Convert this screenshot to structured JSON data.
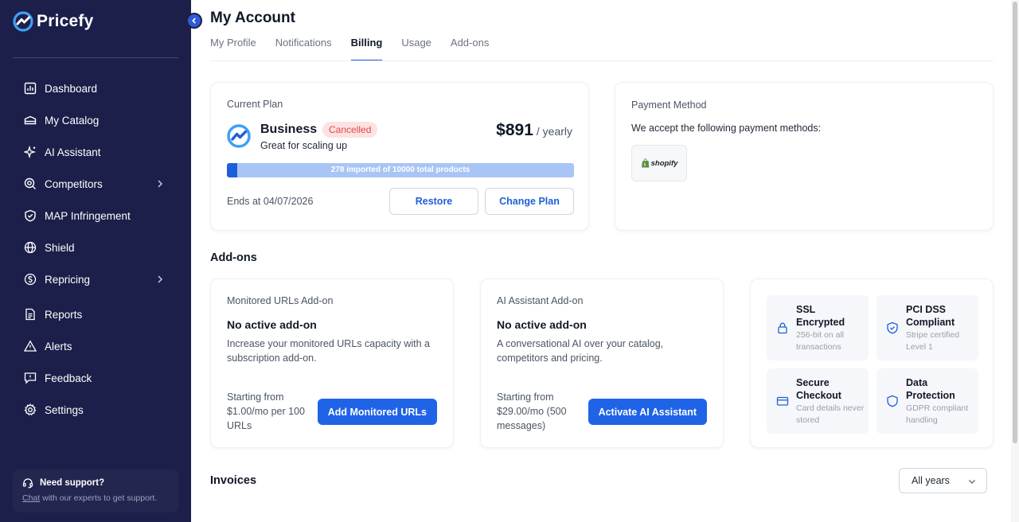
{
  "app": {
    "name": "Pricefy",
    "accent": "#1f5fd9",
    "sidebar_bg": "#1c1f4a"
  },
  "sidebar": {
    "items": [
      {
        "label": "Dashboard",
        "icon": "dashboard-icon"
      },
      {
        "label": "My Catalog",
        "icon": "catalog-icon"
      },
      {
        "label": "AI Assistant",
        "icon": "sparkle-icon"
      },
      {
        "label": "Competitors",
        "icon": "competitors-icon",
        "has_submenu": true
      },
      {
        "label": "MAP Infringement",
        "icon": "shield-check-icon"
      },
      {
        "label": "Shield",
        "icon": "globe-icon"
      },
      {
        "label": "Repricing",
        "icon": "repricing-icon",
        "has_submenu": true
      },
      {
        "label": "Reports",
        "icon": "document-icon"
      },
      {
        "label": "Alerts",
        "icon": "warning-icon"
      },
      {
        "label": "Feedback",
        "icon": "feedback-icon"
      },
      {
        "label": "Settings",
        "icon": "gear-icon"
      }
    ],
    "support": {
      "title": "Need support?",
      "link": "Chat",
      "text": " with our experts to get support."
    }
  },
  "page": {
    "title": "My Account",
    "tabs": [
      {
        "label": "My Profile",
        "active": false
      },
      {
        "label": "Notifications",
        "active": false
      },
      {
        "label": "Billing",
        "active": true
      },
      {
        "label": "Usage",
        "active": false
      },
      {
        "label": "Add-ons",
        "active": false
      }
    ]
  },
  "plan": {
    "card_title": "Current Plan",
    "name": "Business",
    "status": "Cancelled",
    "tagline": "Great for scaling up",
    "price": "$891",
    "period": "/ yearly",
    "progress_label": "278 imported of 10000 total products",
    "imported": 278,
    "total": 10000,
    "ends": "Ends at 04/07/2026",
    "restore_label": "Restore",
    "change_label": "Change Plan"
  },
  "payment": {
    "card_title": "Payment Method",
    "text": "We accept the following payment methods:",
    "method": "shopify"
  },
  "addons": {
    "section_title": "Add-ons",
    "items": [
      {
        "title": "Monitored URLs Add-on",
        "status": "No active add-on",
        "description": "Increase your monitored URLs capacity with a subscription add-on.",
        "price": "Starting from $1.00/mo per 100 URLs",
        "button": "Add Monitored URLs"
      },
      {
        "title": "AI Assistant Add-on",
        "status": "No active add-on",
        "description": "A conversational AI over your catalog, competitors and pricing.",
        "price": "Starting from $29.00/mo (500 messages)",
        "button": "Activate AI Assistant"
      }
    ],
    "trust": [
      {
        "title": "SSL Encrypted",
        "subtitle": "256-bit on all transactions",
        "icon": "lock-icon"
      },
      {
        "title": "PCI DSS Compliant",
        "subtitle": "Stripe certified Level 1",
        "icon": "shield-check-icon"
      },
      {
        "title": "Secure Checkout",
        "subtitle": "Card details never stored",
        "icon": "credit-card-icon"
      },
      {
        "title": "Data Protection",
        "subtitle": "GDPR compliant handling",
        "icon": "shield-icon"
      }
    ]
  },
  "invoices": {
    "section_title": "Invoices",
    "filter_value": "All years"
  }
}
